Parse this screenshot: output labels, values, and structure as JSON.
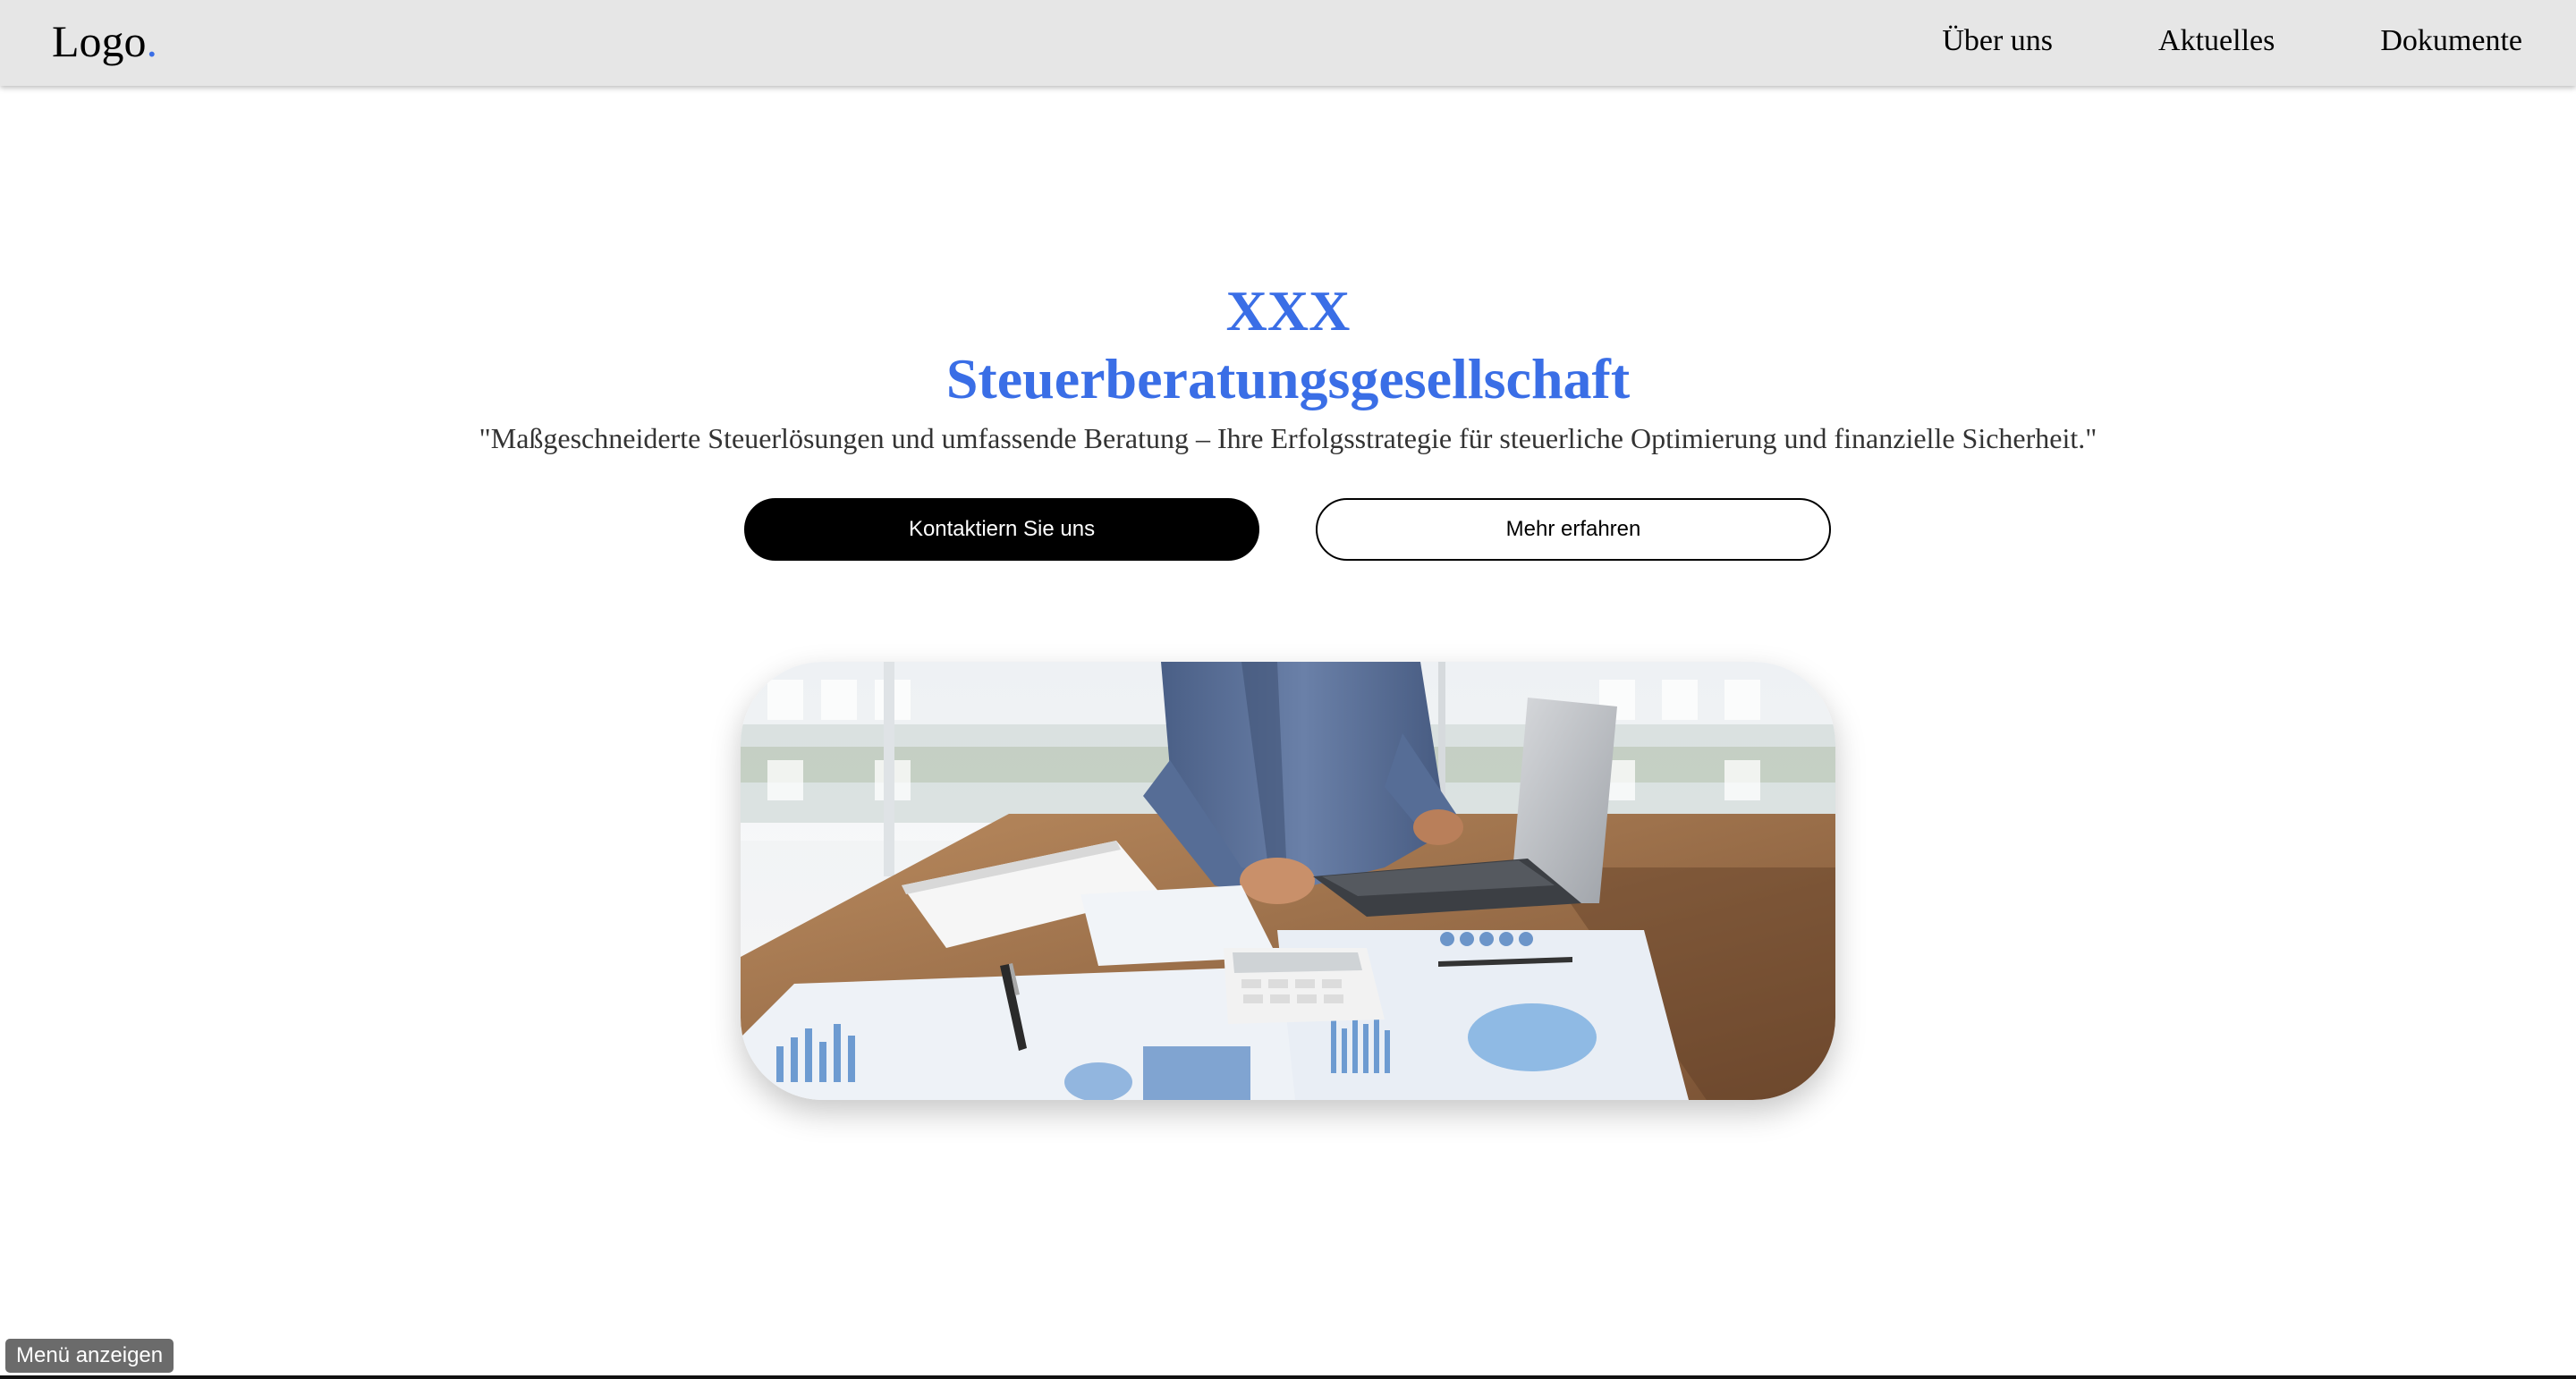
{
  "header": {
    "logo_text": "Logo",
    "logo_dot": ".",
    "nav": [
      "Über uns",
      "Aktuelles",
      "Dokumente"
    ]
  },
  "hero": {
    "title_line1": "XXX",
    "title_line2": "Steuerberatungsgesellschaft",
    "subtitle": "\"Maßgeschneiderte Steuerlösungen und umfassende Beratung – Ihre Erfolgsstrategie für steuerliche Optimierung und finanzielle Sicherheit.\"",
    "primary_button": "Kontaktiern Sie uns",
    "secondary_button": "Mehr erfahren"
  },
  "image": {
    "subject": "person-using-calculator-with-laptop-and-financial-documents"
  },
  "footer": {
    "menu_toggle": "Menü anzeigen"
  },
  "colors": {
    "accent": "#3a6ee6",
    "header_bg": "#e6e6e6",
    "primary_button_bg": "#000000",
    "menu_toggle_bg": "#6b6b6b"
  }
}
